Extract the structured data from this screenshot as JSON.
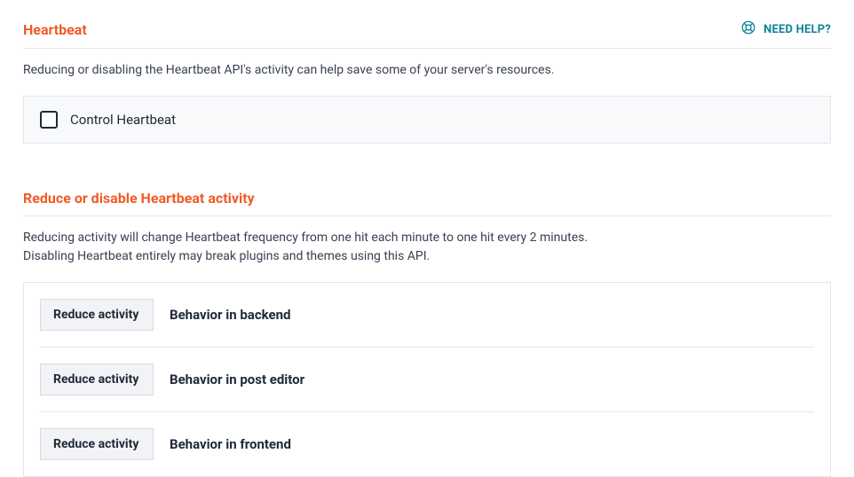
{
  "section1": {
    "title": "Heartbeat",
    "help_label": "NEED HELP?",
    "description": "Reducing or disabling the Heartbeat API's activity can help save some of your server's resources.",
    "checkbox_label": "Control Heartbeat"
  },
  "section2": {
    "title": "Reduce or disable Heartbeat activity",
    "description_line1": "Reducing activity will change Heartbeat frequency from one hit each minute to one hit every 2 minutes.",
    "description_line2": "Disabling Heartbeat entirely may break plugins and themes using this API.",
    "rows": [
      {
        "select_value": "Reduce activity",
        "label": "Behavior in backend"
      },
      {
        "select_value": "Reduce activity",
        "label": "Behavior in post editor"
      },
      {
        "select_value": "Reduce activity",
        "label": "Behavior in frontend"
      }
    ]
  }
}
